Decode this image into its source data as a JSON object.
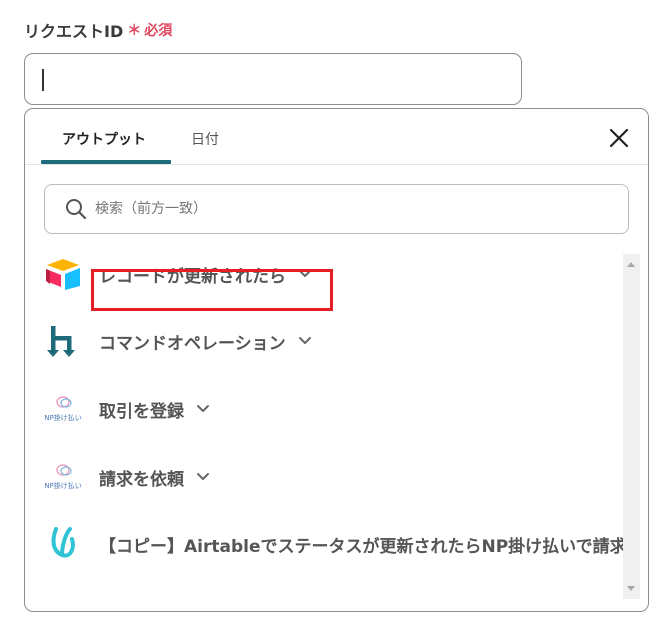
{
  "field": {
    "label": "リクエストID",
    "required_mark": "＊",
    "required_text": "必須",
    "value": ""
  },
  "panel": {
    "tabs": [
      {
        "label": "アウトプット",
        "active": true
      },
      {
        "label": "日付",
        "active": false
      }
    ],
    "search_placeholder": "検索（前方一致）",
    "items": [
      {
        "label": "レコードが更新されたら",
        "icon": "airtable-icon",
        "expandable": true,
        "highlighted": true
      },
      {
        "label": "コマンドオペレーション",
        "icon": "command-operation-icon",
        "expandable": true
      },
      {
        "label": "取引を登録",
        "icon": "np-kakebarai-icon",
        "icon_text": "NP掛け払い",
        "expandable": true
      },
      {
        "label": "請求を依頼",
        "icon": "np-kakebarai-icon",
        "icon_text": "NP掛け払い",
        "expandable": true
      },
      {
        "label": "【コピー】Airtableでステータスが更新されたらNP掛け払いで請求",
        "icon": "yoom-icon",
        "expandable": false
      }
    ]
  },
  "colors": {
    "accent": "#1d6a7a",
    "required": "#e0485e",
    "highlight_border": "#e51e26"
  }
}
